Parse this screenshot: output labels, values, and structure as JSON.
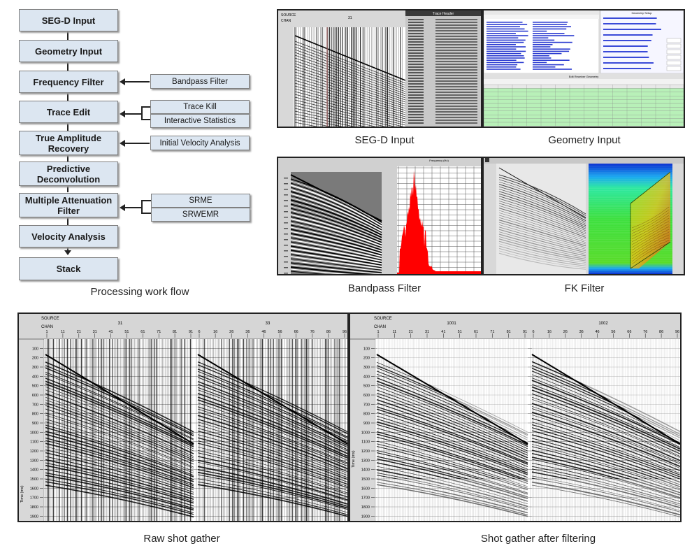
{
  "workflow": {
    "title": "Processing work flow",
    "steps": [
      {
        "label": "SEG-D Input"
      },
      {
        "label": "Geometry Input"
      },
      {
        "label": "Frequency Filter"
      },
      {
        "label": "Trace Edit"
      },
      {
        "label": "True Amplitude Recovery"
      },
      {
        "label": "Predictive Deconvolution"
      },
      {
        "label": "Multiple Attenuation Filter"
      },
      {
        "label": "Velocity Analysis"
      },
      {
        "label": "Stack"
      }
    ],
    "side_boxes": {
      "frequency_filter": [
        "Bandpass Filter"
      ],
      "trace_edit": [
        "Trace Kill",
        "Interactive Statistics"
      ],
      "true_amplitude": [
        "Initial Velocity Analysis"
      ],
      "multiple_attenuation": [
        "SRME",
        "SRWEMR"
      ]
    }
  },
  "panels": {
    "segd": {
      "caption": "SEG-D Input",
      "header": "SOURCE",
      "sub": "CHAN",
      "source": "31",
      "dialog_title": "Trace Header"
    },
    "geometry": {
      "caption": "Geometry Input",
      "table_title": "Edit Receiver Geometry",
      "right_title": "Geometry Setup"
    },
    "bandpass": {
      "caption": "Bandpass Filter",
      "x_title": "Frequency (Hz)",
      "fill_color": "#ff0000"
    },
    "fk": {
      "caption": "FK Filter"
    }
  },
  "gathers": {
    "raw": {
      "caption": "Raw shot gather",
      "header": "SOURCE",
      "sub": "CHAN",
      "sources": [
        "31",
        "33"
      ],
      "ticks_a": [
        "1",
        "11",
        "21",
        "31",
        "41",
        "51",
        "61",
        "71",
        "81",
        "91"
      ],
      "ticks_b": [
        "6",
        "16",
        "26",
        "36",
        "46",
        "56",
        "66",
        "76",
        "86",
        "96"
      ],
      "time_ticks": [
        "100",
        "200",
        "300",
        "400",
        "500",
        "600",
        "700",
        "800",
        "900",
        "1000",
        "1100",
        "1200",
        "1300",
        "1400",
        "1500",
        "1600",
        "1700",
        "1800",
        "1900"
      ],
      "time_label": "Time (ms)"
    },
    "filtered": {
      "caption": "Shot gather after filtering",
      "header": "SOURCE",
      "sub": "CHAN",
      "sources": [
        "1001",
        "1002"
      ],
      "ticks_a": [
        "1",
        "11",
        "21",
        "31",
        "41",
        "51",
        "61",
        "71",
        "81",
        "91"
      ],
      "ticks_b": [
        "6",
        "16",
        "26",
        "36",
        "46",
        "56",
        "66",
        "76",
        "86",
        "96"
      ],
      "time_ticks": [
        "100",
        "200",
        "300",
        "400",
        "500",
        "600",
        "700",
        "800",
        "900",
        "1000",
        "1100",
        "1200",
        "1300",
        "1400",
        "1500",
        "1600",
        "1700",
        "1800",
        "1900"
      ],
      "time_label": "Time (ms)"
    }
  }
}
